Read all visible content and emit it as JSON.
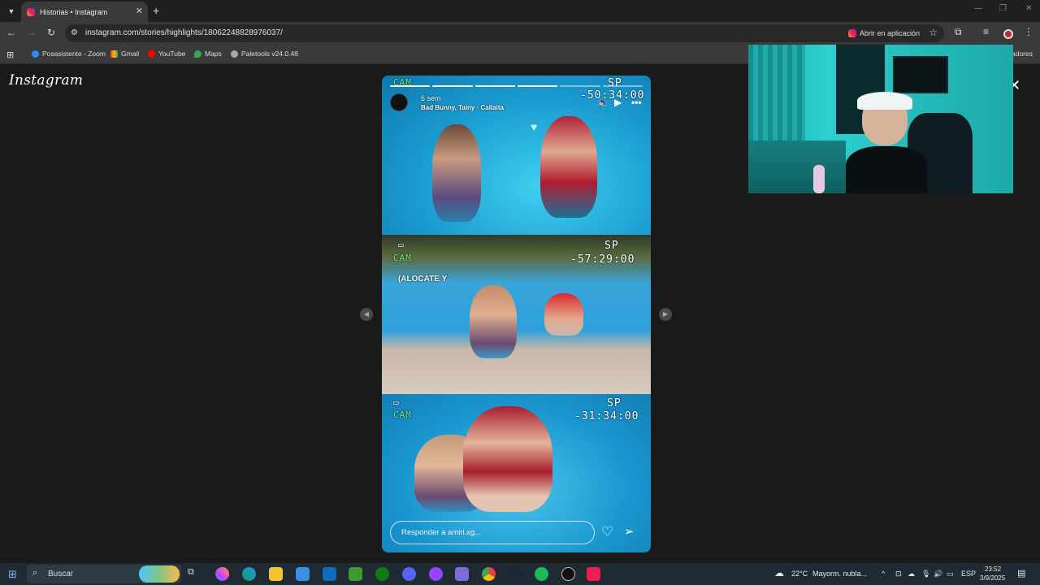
{
  "browser": {
    "tab_title": "Historias • Instagram",
    "url": "instagram.com/stories/highlights/18062248828976037/",
    "open_app_label": "Abrir en aplicación",
    "bookmarks": [
      "Posasistente - Zoom",
      "Gmail",
      "YouTube",
      "Maps",
      "Paletools v24.0.48"
    ],
    "bookmarks_overflow": "adores"
  },
  "instagram": {
    "logo": "Instagram",
    "story": {
      "age": "6 sem",
      "song": "Bad Bunny, Tainy · Callaita",
      "reply_placeholder": "Responder a amiri.xg...",
      "overlay_text": "(ALOCATE Y",
      "panels": [
        {
          "cam": "CAM",
          "mode": "SP",
          "time": "-50:34:00"
        },
        {
          "cam": "CAM",
          "mode": "SP",
          "time": "-57:29:00"
        },
        {
          "cam": "CAM",
          "mode": "SP",
          "time": "-31:34:00"
        }
      ],
      "progress_segments": 6,
      "progress_done": 4
    }
  },
  "taskbar": {
    "search_label": "Buscar",
    "weather_temp": "22°C",
    "weather_desc": "Mayorm. nubla...",
    "language": "ESP",
    "time": "23:52",
    "date": "3/9/2025"
  }
}
